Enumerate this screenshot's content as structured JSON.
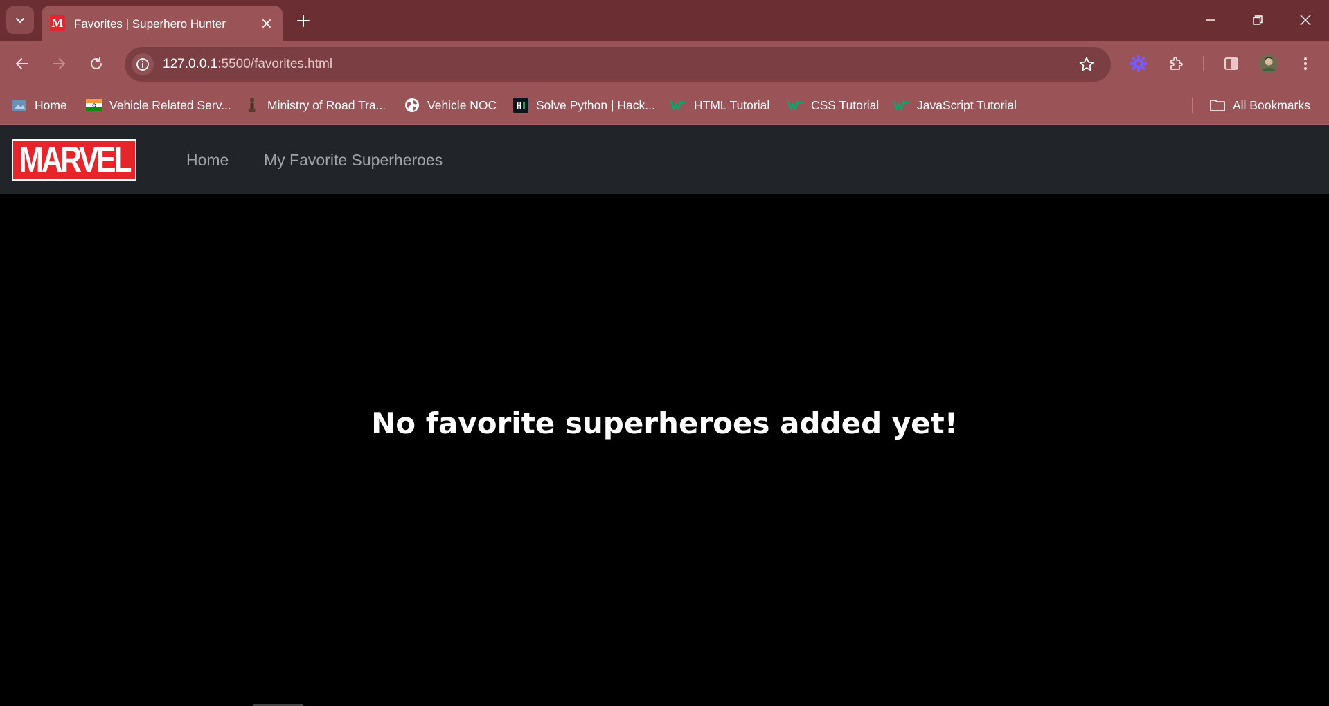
{
  "browser": {
    "tab": {
      "favicon": "M",
      "title": "Favorites | Superhero Hunter"
    },
    "new_tab": "+",
    "url": {
      "host": "127.0.0.1",
      "path": ":5500/favorites.html"
    },
    "bookmarks": [
      {
        "label": "Home",
        "icon": "home-bookmark-icon"
      },
      {
        "label": "Vehicle Related Serv...",
        "icon": "india-flag-icon"
      },
      {
        "label": "Ministry of Road Tra...",
        "icon": "emblem-icon"
      },
      {
        "label": "Vehicle NOC",
        "icon": "globe-icon"
      },
      {
        "label": "Solve Python | Hack...",
        "icon": "hackerrank-icon"
      },
      {
        "label": "HTML Tutorial",
        "icon": "w3schools-icon"
      },
      {
        "label": "CSS Tutorial",
        "icon": "w3schools-icon"
      },
      {
        "label": "JavaScript Tutorial",
        "icon": "w3schools-icon"
      }
    ],
    "all_bookmarks": "All Bookmarks",
    "colors": {
      "tabstrip": "#6b2f33",
      "toolbar": "#9a5458",
      "omnibox": "#7b3f43"
    }
  },
  "site": {
    "logo_text": "MARVEL",
    "nav": {
      "home": "Home",
      "favorites": "My Favorite Superheroes"
    },
    "empty_message": "No favorite superheroes added yet!",
    "colors": {
      "navbar": "#212529",
      "brand_red": "#e62429",
      "background": "#000000"
    }
  }
}
